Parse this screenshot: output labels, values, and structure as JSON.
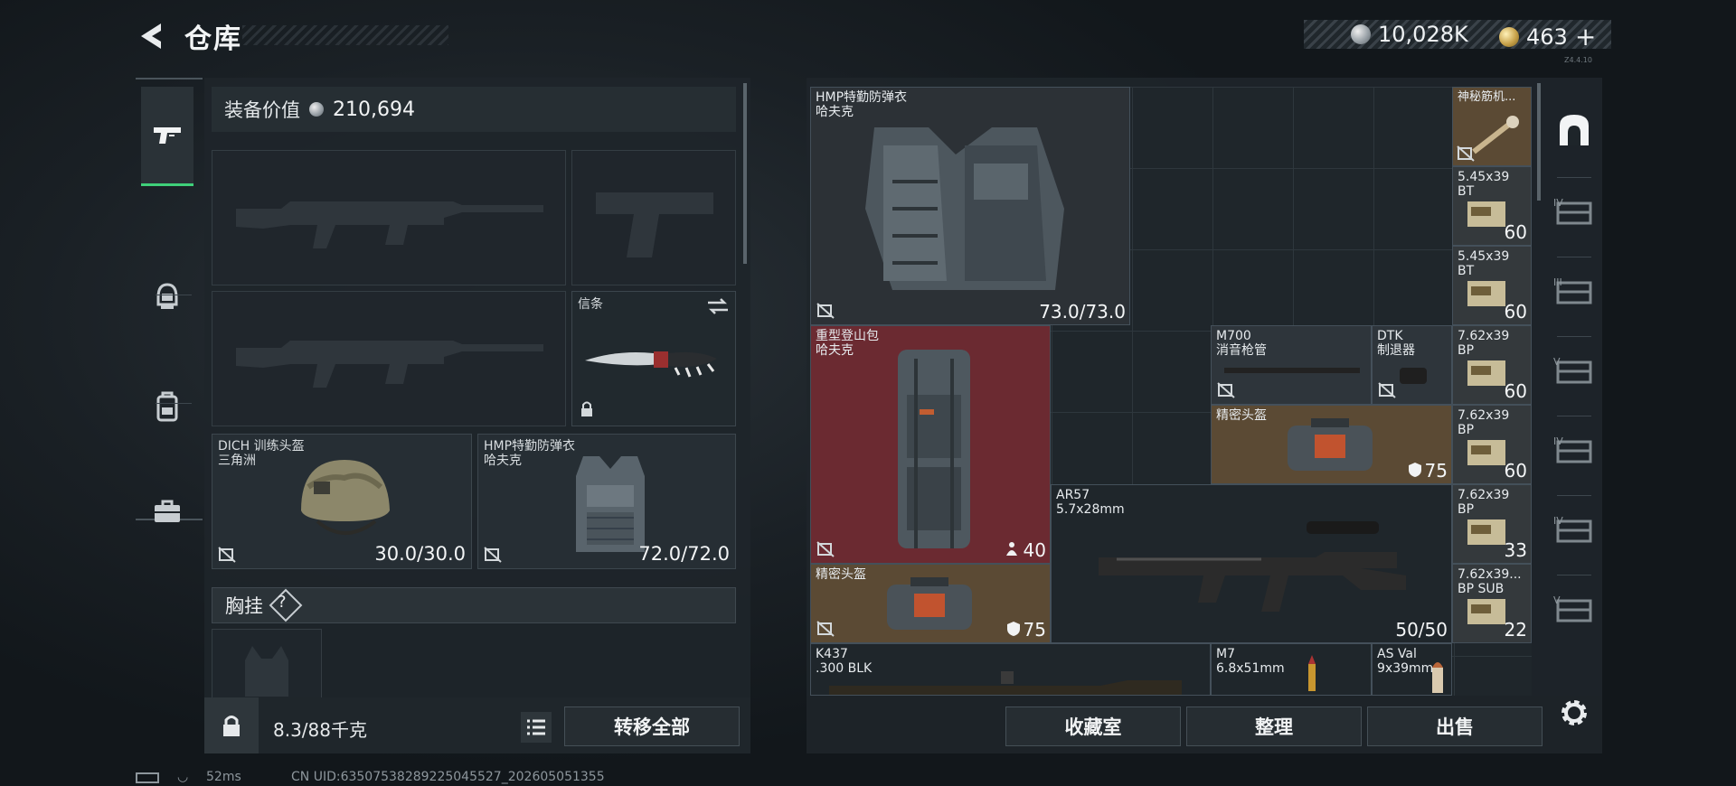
{
  "header": {
    "title": "仓库",
    "silver_value": "10,028K",
    "gold_value": "463",
    "plus": "+",
    "version_tag": "Z4.4.10"
  },
  "side_nav": {
    "items": [
      {
        "icon": "pistol-icon",
        "active": true
      },
      {
        "icon": "helmet-icon",
        "active": false
      },
      {
        "icon": "backpack-icon",
        "active": false
      },
      {
        "icon": "briefcase-icon",
        "active": false
      }
    ]
  },
  "loadout": {
    "equipment_value_label": "装备价值",
    "equipment_value": "210,694",
    "melee": {
      "label": "信条"
    },
    "helmet": {
      "name": "DICH 训练头盔",
      "brand": "三角洲",
      "durability": "30.0/30.0"
    },
    "armor": {
      "name": "HMP特勤防弹衣",
      "brand": "哈夫克",
      "durability": "72.0/72.0"
    },
    "chest_rig": {
      "label": "胸挂",
      "help": "?"
    },
    "weight": "8.3/88千克",
    "transfer_all": "转移全部"
  },
  "stash": {
    "items": [
      {
        "key": "armor",
        "name": "HMP特勤防弹衣\n哈夫克",
        "count": "73.0/73.0"
      },
      {
        "key": "backpack",
        "name": "重型登山包\n哈夫克",
        "count": "40"
      },
      {
        "key": "m700",
        "name": "M700\n消音枪管",
        "count": ""
      },
      {
        "key": "dtk",
        "name": "DTK\n制退器",
        "count": ""
      },
      {
        "key": "case1",
        "name": "精密头盔",
        "count": "75"
      },
      {
        "key": "ar57",
        "name": "AR57\n5.7x28mm",
        "count": "50/50"
      },
      {
        "key": "case2",
        "name": "精密头盔",
        "count": "75"
      },
      {
        "key": "k437",
        "name": "K437\n.300 BLK",
        "count": ""
      },
      {
        "key": "m7",
        "name": "M7\n6.8x51mm",
        "count": ""
      },
      {
        "key": "asval",
        "name": "AS Val\n9x39mm",
        "count": ""
      },
      {
        "key": "mystery",
        "name": "神秘筋机...",
        "count": ""
      }
    ],
    "ammo": [
      {
        "name": "5.45x39\nBT",
        "count": "60"
      },
      {
        "name": "5.45x39\nBT",
        "count": "60"
      },
      {
        "name": "7.62x39\nBP",
        "count": "60"
      },
      {
        "name": "7.62x39\nBP",
        "count": "60"
      },
      {
        "name": "7.62x39\nBP",
        "count": "33"
      },
      {
        "name": "7.62x39...\nBP SUB",
        "count": "22"
      }
    ]
  },
  "buttons": {
    "collection": "收藏室",
    "sort": "整理",
    "sell": "出售"
  },
  "right_tabs": [
    "key-icon",
    "IV",
    "III",
    "V",
    "IV",
    "IV",
    "V"
  ],
  "status_bar": {
    "ping": "52ms",
    "uid": "CN UID:6350753828922504552​7_202605051355"
  },
  "colors": {
    "accent_green": "#3fd07a",
    "rare_red": "#6b2a31",
    "rare_gold": "#5b4a34",
    "panel": "#1e252a"
  }
}
